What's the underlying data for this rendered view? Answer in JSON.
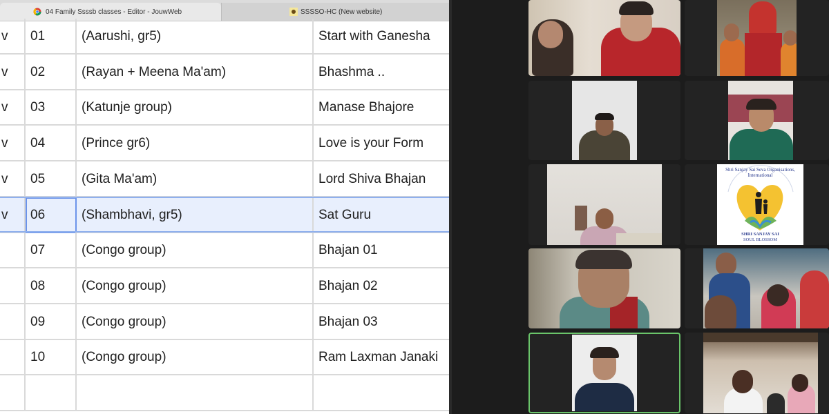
{
  "browser": {
    "tabs": [
      {
        "label": "04 Family Ssssb classes - Editor - JouwWeb",
        "icon": "chrome-icon"
      },
      {
        "label": "SSSSO-HC (New website)",
        "icon": "site-favicon"
      }
    ]
  },
  "sheet": {
    "rows": [
      {
        "mark": "v",
        "no": "01",
        "who": "(Aarushi, gr5)",
        "song": "Start with Ganesha"
      },
      {
        "mark": "v",
        "no": "02",
        "who": "(Rayan + Meena Ma'am)",
        "song": "Bhashma .."
      },
      {
        "mark": "v",
        "no": "03",
        "who": "(Katunje group)",
        "song": "Manase Bhajore"
      },
      {
        "mark": "v",
        "no": "04",
        "who": "(Prince gr6)",
        "song": "Love is your Form"
      },
      {
        "mark": "v",
        "no": "05",
        "who": "(Gita Ma'am)",
        "song": "Lord Shiva Bhajan"
      },
      {
        "mark": "v",
        "no": "06",
        "who": "(Shambhavi, gr5)",
        "song": "Sat Guru"
      },
      {
        "mark": "",
        "no": "07",
        "who": "(Congo group)",
        "song": "Bhajan 01"
      },
      {
        "mark": "",
        "no": "08",
        "who": "(Congo group)",
        "song": "Bhajan 02"
      },
      {
        "mark": "",
        "no": "09",
        "who": "(Congo group)",
        "song": "Bhajan 03"
      },
      {
        "mark": "",
        "no": "10",
        "who": "(Congo group)",
        "song": "Ram Laxman Janaki"
      },
      {
        "mark": "",
        "no": "",
        "who": "",
        "song": ""
      }
    ],
    "selected_row": 5
  },
  "meeting": {
    "logo": {
      "arc_text": "Shri Sanjay Sai Seva Organisations, International",
      "line1": "SHRI SANJAY SAI",
      "line2": "SOUL BLOSSOM"
    },
    "colors": {
      "tile_bg": "#232323",
      "speaking_border": "#6ac46a"
    }
  }
}
